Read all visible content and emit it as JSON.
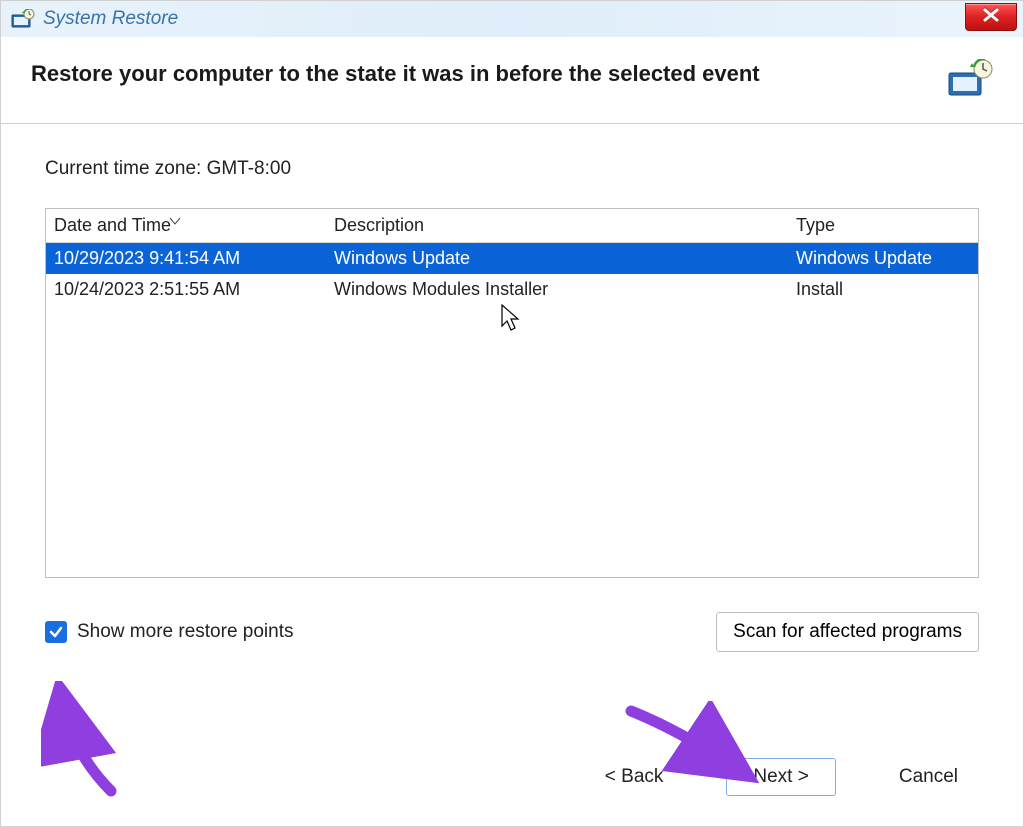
{
  "window": {
    "title": "System Restore"
  },
  "header": {
    "title": "Restore your computer to the state it was in before the selected event"
  },
  "timezone_label": "Current time zone: GMT-8:00",
  "table": {
    "headers": {
      "datetime": "Date and Time",
      "description": "Description",
      "type": "Type"
    },
    "rows": [
      {
        "datetime": "10/29/2023 9:41:54 AM",
        "description": "Windows Update",
        "type": "Windows Update",
        "selected": true
      },
      {
        "datetime": "10/24/2023 2:51:55 AM",
        "description": "Windows Modules Installer",
        "type": "Install",
        "selected": false
      }
    ]
  },
  "show_more_checkbox": {
    "checked": true,
    "label": "Show more restore points"
  },
  "scan_button_label": "Scan for affected programs",
  "footer": {
    "back": "< Back",
    "next": "Next >",
    "cancel": "Cancel"
  }
}
